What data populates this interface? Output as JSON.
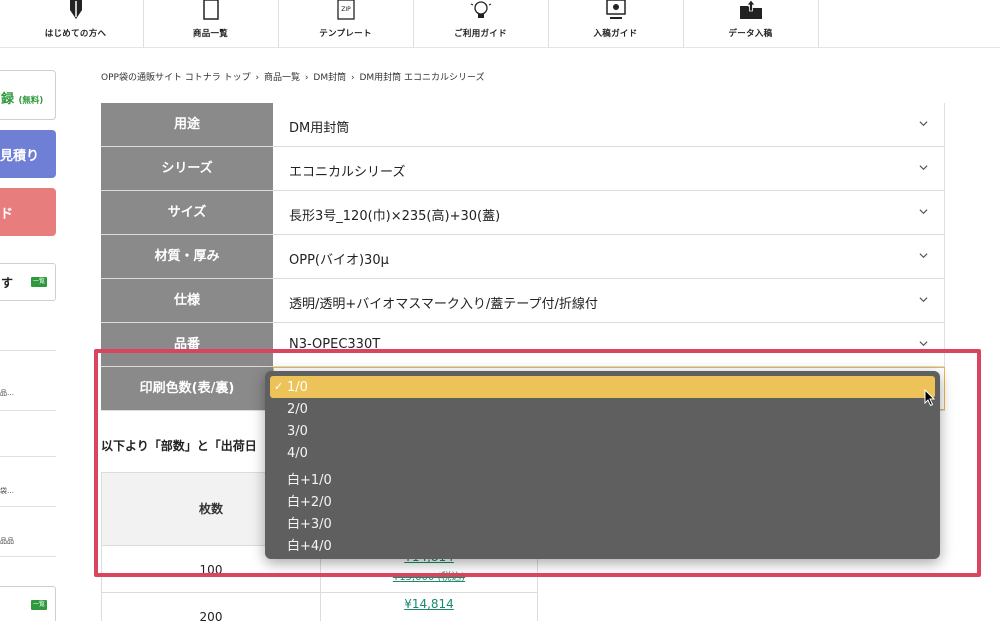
{
  "topnav": {
    "items": [
      {
        "label": "はじめての方へ",
        "icon": "shield-icon"
      },
      {
        "label": "商品一覧",
        "icon": "document-icon"
      },
      {
        "label": "テンプレート",
        "icon": "zip-file-icon"
      },
      {
        "label": "ご利用ガイド",
        "icon": "lightbulb-icon"
      },
      {
        "label": "入稿ガイド",
        "icon": "monitor-icon"
      },
      {
        "label": "データ入稿",
        "icon": "folder-upload-icon"
      }
    ],
    "zip_text": "ZIP"
  },
  "sidebar": {
    "register_label": "録",
    "register_note": "(無料)",
    "quote_label": "見積り",
    "download_label": "ド",
    "list_label": "す",
    "list_badge": "一覧",
    "fragments": [
      "品…",
      "袋…",
      "品品"
    ]
  },
  "breadcrumb": {
    "items": [
      "OPP袋の通販サイト コトナラ トップ",
      "商品一覧",
      "DM封筒",
      "DM用封筒 エコニカルシリーズ"
    ],
    "separator": "›"
  },
  "options": {
    "rows": [
      {
        "label": "用途",
        "value": "DM用封筒"
      },
      {
        "label": "シリーズ",
        "value": "エコニカルシリーズ"
      },
      {
        "label": "サイズ",
        "value": "長形3号_120(巾)×235(高)+30(蓋)"
      },
      {
        "label": "材質・厚み",
        "value": "OPP(バイオ)30μ"
      },
      {
        "label": "仕様",
        "value": "透明/透明+バイオマスマーク入り/蓋テープ付/折線付"
      },
      {
        "label": "品番",
        "value": "N3-OPEC330T"
      },
      {
        "label": "印刷色数(表/裏)",
        "value": ""
      }
    ]
  },
  "quantity": {
    "heading": "以下より「部数」と「出荷日",
    "col_header": "枚数",
    "rows": [
      {
        "count": "100",
        "price": "¥14,814",
        "old_price": "¥15,000 (税込)"
      },
      {
        "count": "200",
        "price": "¥14,814",
        "old_price": ""
      }
    ]
  },
  "dropdown": {
    "options": [
      "1/0",
      "2/0",
      "3/0",
      "4/0",
      "白+1/0",
      "白+2/0",
      "白+3/0",
      "白+4/0"
    ],
    "selected_index": 0,
    "check_mark": "✓"
  },
  "colors": {
    "label_bg": "#8a8a8a",
    "highlight_border": "#d9455f",
    "dropdown_bg": "#5f5f5f",
    "selected_bg": "#edc258",
    "price_link": "#1a8a6f",
    "brand_green": "#2e9a3d"
  }
}
